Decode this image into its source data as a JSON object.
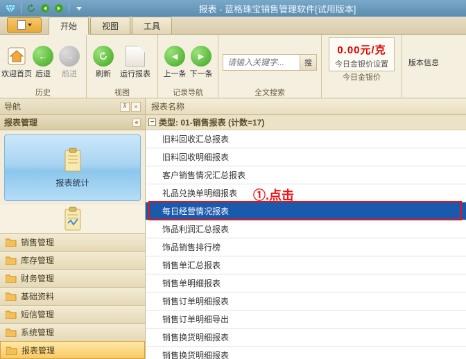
{
  "title": "报表 - 蓝格珠宝销售管理软件[试用版本]",
  "tabs": {
    "start": "开始",
    "view": "视图",
    "tools": "工具"
  },
  "ribbon": {
    "history": {
      "label": "历史",
      "home": "欢迎首页",
      "back": "后退",
      "forward": "前进"
    },
    "viewg": {
      "label": "视图",
      "refresh": "刷新",
      "run": "运行报表"
    },
    "record": {
      "label": "记录导航",
      "prev": "上一条",
      "next": "下一条"
    },
    "search": {
      "label": "全文搜索",
      "placeholder": "请输入关键字...",
      "btn": "搜"
    },
    "price": {
      "label": "今日金银价",
      "value": "0.00元/克",
      "sub": "今日金银价设置"
    },
    "version": {
      "label": "",
      "btn": "版本信息"
    }
  },
  "nav": {
    "title": "导航",
    "sub": "报表管理",
    "tile": "报表统计",
    "items": [
      "销售管理",
      "库存管理",
      "财务管理",
      "基础资料",
      "短信管理",
      "系统管理",
      "报表管理"
    ],
    "selected_index": 6
  },
  "content": {
    "header": "报表名称",
    "group": "类型: 01-销售报表 (计数=17)",
    "items": [
      "旧料回收汇总报表",
      "旧料回收明细报表",
      "客户销售情况汇总报表",
      "礼品兑换单明细报表",
      "每日经营情况报表",
      "饰品利润汇总报表",
      "饰品销售排行榜",
      "销售单汇总报表",
      "销售单明细报表",
      "销售订单明细报表",
      "销售订单明细导出",
      "销售换货明细报表",
      "销售换货明细报表"
    ],
    "highlight_index": 4
  },
  "annotation": {
    "text": "①.点击"
  }
}
